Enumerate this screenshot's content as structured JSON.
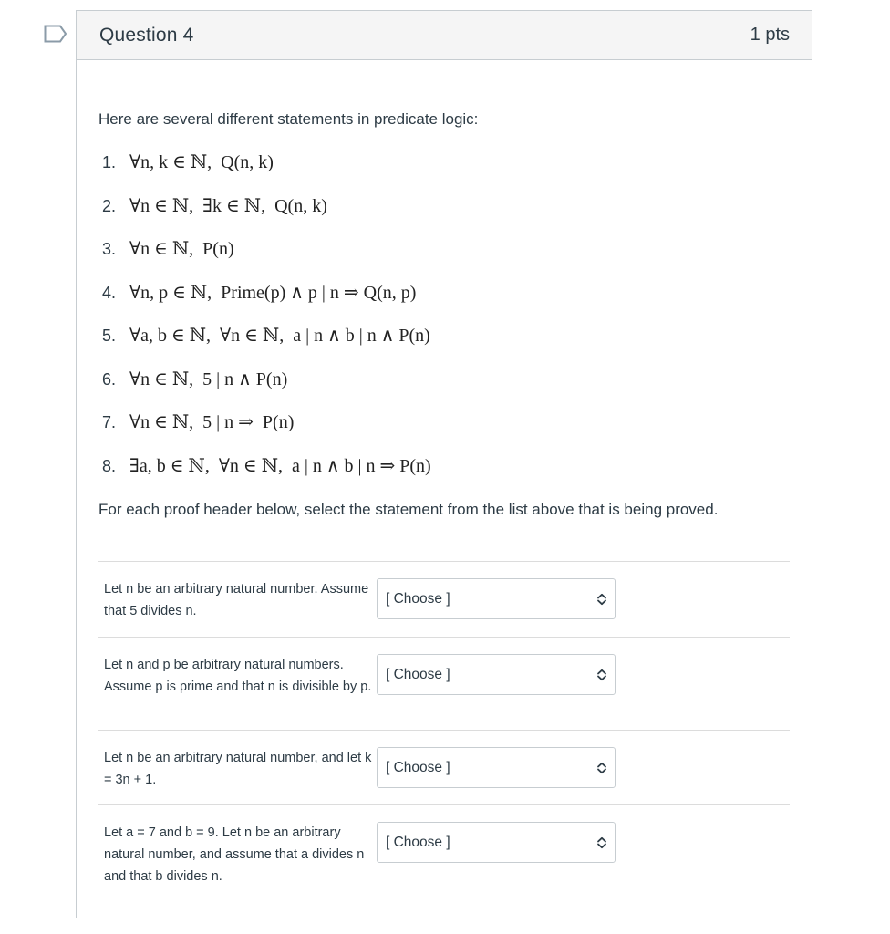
{
  "question": {
    "title": "Question 4",
    "points": "1 pts",
    "flag_icon": "bookmark-flag-icon"
  },
  "content": {
    "intro": "Here are several different statements in predicate logic:",
    "statements": [
      {
        "number": "1.",
        "text": "∀n, k ∈ ℕ,  Q(n, k)"
      },
      {
        "number": "2.",
        "text": "∀n ∈ ℕ,  ∃k ∈ ℕ,  Q(n, k)"
      },
      {
        "number": "3.",
        "text": "∀n ∈ ℕ,  P(n)"
      },
      {
        "number": "4.",
        "text": "∀n, p ∈ ℕ,  Prime(p) ∧ p | n ⇒ Q(n, p)"
      },
      {
        "number": "5.",
        "text": "∀a, b ∈ ℕ,  ∀n ∈ ℕ,  a | n ∧ b | n ∧ P(n)"
      },
      {
        "number": "6.",
        "text": "∀n ∈ ℕ,  5 | n ∧ P(n)"
      },
      {
        "number": "7.",
        "text": "∀n ∈ ℕ,  5 | n ⇒  P(n)"
      },
      {
        "number": "8.",
        "text": "∃a, b ∈ ℕ,  ∀n ∈ ℕ,  a | n ∧ b | n ⇒ P(n)"
      }
    ],
    "instruction": "For each proof header below, select the statement from the list above that is being proved."
  },
  "matches": [
    {
      "prompt": "Let n be an arbitrary natural number. Assume that 5 divides n.",
      "selected": "[ Choose ]"
    },
    {
      "prompt": "Let n and p be arbitrary natural numbers. Assume p is prime and that n is divisible by p.",
      "selected": "[ Choose ]"
    },
    {
      "prompt": "Let n be an arbitrary natural number, and let k = 3n + 1.",
      "selected": "[ Choose ]"
    },
    {
      "prompt": "Let a = 7 and b = 9. Let n be an arbitrary natural number, and assume that a divides n and that b divides n.",
      "selected": "[ Choose ]"
    }
  ],
  "colors": {
    "header_bg": "#f5f5f5",
    "border": "#c7cdd1",
    "text": "#2d3b45",
    "flag": "#8b9ba8"
  }
}
